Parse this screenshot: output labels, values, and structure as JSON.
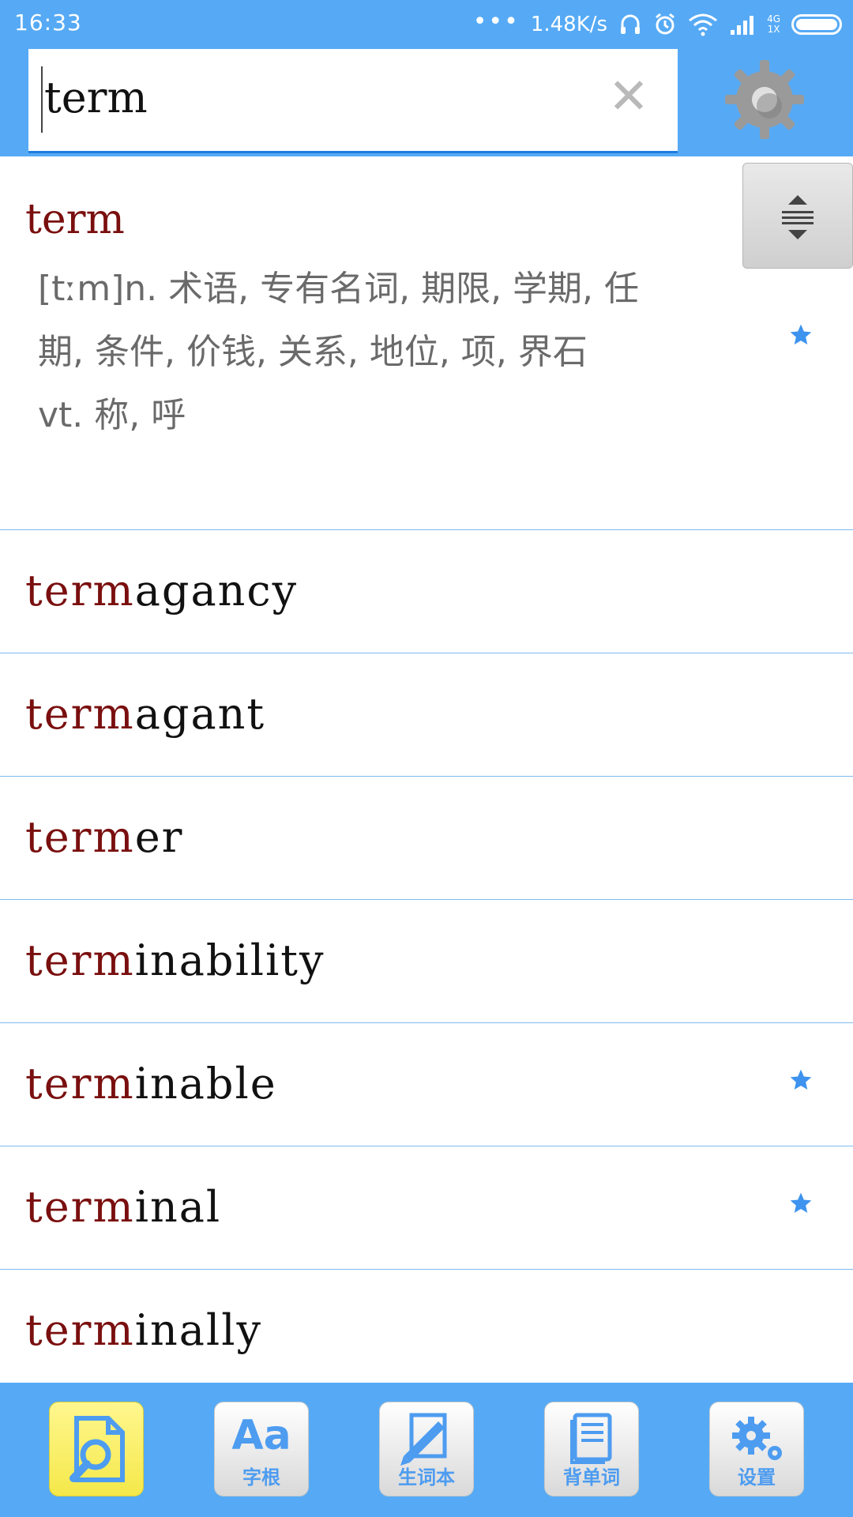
{
  "status_bar": {
    "time": "16:33",
    "dots": "•••",
    "network_speed": "1.48K/s",
    "network_type": "4G",
    "sim": "1X"
  },
  "search": {
    "query": "term"
  },
  "main_entry": {
    "word": "term",
    "definition_lines": [
      "[tːm]n. 术语, 专有名词, 期限, 学期, 任",
      "期, 条件, 价钱, 关系, 地位, 项, 界石",
      "vt. 称, 呼"
    ],
    "starred": true
  },
  "results": [
    {
      "highlight": "term",
      "rest": "agancy",
      "starred": false
    },
    {
      "highlight": "term",
      "rest": "agant",
      "starred": false
    },
    {
      "highlight": "term",
      "rest": "er",
      "starred": false
    },
    {
      "highlight": "term",
      "rest": "inability",
      "starred": false
    },
    {
      "highlight": "term",
      "rest": "inable",
      "starred": true
    },
    {
      "highlight": "term",
      "rest": "inal",
      "starred": true
    },
    {
      "highlight": "term",
      "rest": "inally",
      "starred": false
    }
  ],
  "bottom_nav": [
    {
      "id": "search",
      "label": "",
      "glyph": "",
      "active": true
    },
    {
      "id": "roots",
      "label": "字根",
      "glyph": "Aa",
      "active": false
    },
    {
      "id": "wordbook",
      "label": "生词本",
      "glyph": "",
      "active": false
    },
    {
      "id": "memorize",
      "label": "背单词",
      "glyph": "",
      "active": false
    },
    {
      "id": "settings",
      "label": "设置",
      "glyph": "",
      "active": false
    }
  ],
  "colors": {
    "primary": "#56aaf5",
    "highlight_text": "#7a0f0f",
    "star": "#3d93ee",
    "divider": "#7fbaf0"
  }
}
